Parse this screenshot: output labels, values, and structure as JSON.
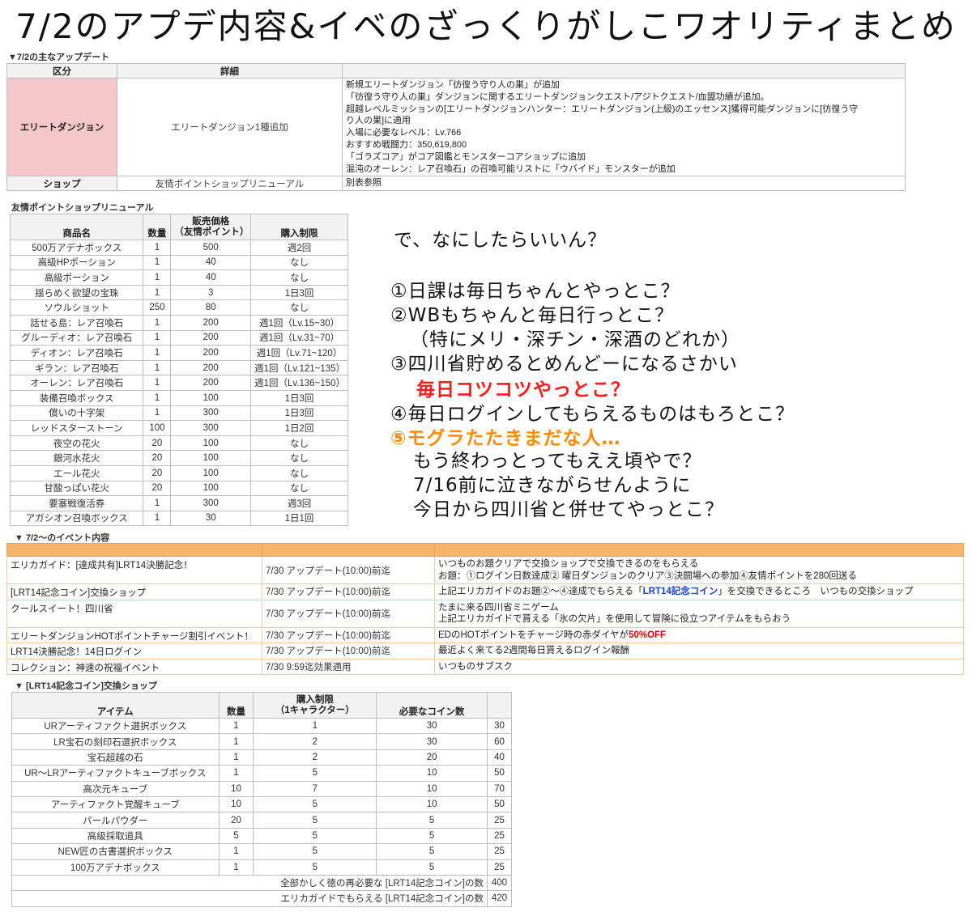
{
  "title": "7/2のアプデ内容&イベのざっくりがしこワオリティまとめ",
  "update_section": {
    "label": "▼7/2の主なアップデート",
    "headers": [
      "区分",
      "詳細",
      ""
    ],
    "rows": [
      {
        "category": "エリートダンジョン",
        "summary": "エリートダンジョン1種追加",
        "details": [
          "新規エリートダンジョン「彷徨う守り人の巣」が追加",
          "「彷徨う守り人の巣」ダンジョンに関するエリートダンジョンクエスト/アジトクエスト/血盟功績が追加。",
          "超越レベルミッションの[エリートダンジョンハンター：エリートダンジョン(上級)のエッセンス]獲得可能ダンジョンに[彷徨う守",
          "り人の巣]に適用",
          "入場に必要なレベル：Lv.766",
          "おすすめ戦闘力：350,619,800",
          "「ゴラズコア」がコア図鑑とモンスターコアショップに追加",
          "混沌のオーレン：レア召喚石」の召喚可能リストに「ウバイド」モンスターが追加"
        ]
      },
      {
        "category": "ショップ",
        "summary": "友情ポイントショップリニューアル",
        "details": [
          "別表参照"
        ]
      }
    ]
  },
  "friend_shop": {
    "label": "友情ポイントショップリニューアル",
    "headers": {
      "name": "商品名",
      "qty": "数量",
      "price": "販売価格\n（友情ポイント）",
      "limit": "購入制限"
    },
    "rows": [
      [
        "500万アデナボックス",
        "1",
        "500",
        "週2回"
      ],
      [
        "高級HPポーション",
        "1",
        "40",
        "なし"
      ],
      [
        "高級ポーション",
        "1",
        "40",
        "なし"
      ],
      [
        "揺らめく欲望の宝珠",
        "1",
        "3",
        "1日3回"
      ],
      [
        "ソウルショット",
        "250",
        "80",
        "なし"
      ],
      [
        "話せる島：レア召喚石",
        "1",
        "200",
        "週1回（Lv.15~30）"
      ],
      [
        "グルーディオ：レア召喚石",
        "1",
        "200",
        "週1回（Lv.31~70）"
      ],
      [
        "ディオン：レア召喚石",
        "1",
        "200",
        "週1回（Lv.71~120）"
      ],
      [
        "ギラン：レア召喚石",
        "1",
        "200",
        "週1回（Lv.121~135）"
      ],
      [
        "オーレン：レア召喚石",
        "1",
        "200",
        "週1回（Lv.136~150）"
      ],
      [
        "装備召喚ボックス",
        "1",
        "100",
        "1日3回"
      ],
      [
        "償いの十字架",
        "1",
        "300",
        "1日3回"
      ],
      [
        "レッドスターストーン",
        "100",
        "300",
        "1日2回"
      ],
      [
        "夜空の花火",
        "20",
        "100",
        "なし"
      ],
      [
        "銀河水花火",
        "20",
        "100",
        "なし"
      ],
      [
        "エール花火",
        "20",
        "100",
        "なし"
      ],
      [
        "甘酸っぱい花火",
        "20",
        "100",
        "なし"
      ],
      [
        "要塞戦復活券",
        "1",
        "300",
        "週3回"
      ],
      [
        "アガシオン召喚ボックス",
        "1",
        "30",
        "1日1回"
      ]
    ]
  },
  "handwritten": {
    "q": "で、なにしたらいいん？",
    "l1": "①日課は毎日ちゃんとやっとこ？",
    "l2": "②WBもちゃんと毎日行っとこ？",
    "l3": "（特にメリ・深チン・深酒のどれか）",
    "l4": "③四川省貯めるとめんどーになるさかい",
    "l5": "毎日コツコツやっとこ？",
    "l6": "④毎日ログインしてもらえるものはもろとこ？",
    "l7": "⑤モグラたたきまだな人…",
    "l8": "もう終わっとってもええ頃やで？",
    "l9": "7/16前に泣きながらせんように",
    "l10": "今日から四川省と併せてやっとこ？"
  },
  "events": {
    "label": "▼ 7/2～のイベント内容",
    "rows": [
      {
        "name": "エリカガイド：[達成共有]LRT14決勝記念！",
        "date": "7/30 アップデート(10:00)前迄",
        "desc1": "いつものお題クリアで交換ショップで交換できるのをもらえる",
        "desc2": "お題：①ログイン日数達成② 曜日ダンジョンのクリア③決闘場への参加④友情ポイントを280回送る"
      },
      {
        "name": "[LRT14記念コイン]交換ショップ",
        "date": "7/30 アップデート(10:00)前迄",
        "desc_a": "上記エリカガイドのお題②～④達成でもらえる「",
        "desc_b": "LRT14記念コイン",
        "desc_c": "」を交換できるところ　いつもの交換ショップ"
      },
      {
        "name": "クールスイート！四川省",
        "date": "7/30 アップデート(10:00)前迄",
        "desc1": "たまに来る四川省ミニゲーム",
        "desc2": "上記エリカガイドで貰える「氷の欠片」を使用して冒険に役立つアイテムをもらおう"
      },
      {
        "name": "エリートダンジョンHOTポイントチャージ割引イベント！",
        "date": "7/30 アップデート(10:00)前迄",
        "desc_a": "EDのHOTポイントをチャージ時の赤ダイヤが",
        "desc_b": "50%OFF"
      },
      {
        "name": "LRT14決勝記念！14日ログイン",
        "date": "7/30 アップデート(10:00)前迄",
        "desc1": "最近よく来てる2週間毎日貰えるログイン報酬"
      },
      {
        "name": "コレクション：神速の祝福イベント",
        "date": "7/30 9:59迄効果適用",
        "desc1": "いつものサブスク"
      }
    ]
  },
  "coin_shop": {
    "label": "▼ [LRT14記念コイン]交換ショップ",
    "headers": {
      "item": "アイテム",
      "qty": "数量",
      "limit": "購入制限\n（1キャラクター）",
      "coins": "必要なコイン数",
      "total": ""
    },
    "rows": [
      [
        "URアーティファクト選択ボックス",
        "1",
        "1",
        "30",
        "30"
      ],
      [
        "LR宝石の刻印石選択ボックス",
        "1",
        "2",
        "30",
        "60"
      ],
      [
        "宝石超越の石",
        "1",
        "2",
        "20",
        "40"
      ],
      [
        "UR～LRアーティファクトキューブボックス",
        "1",
        "5",
        "10",
        "50"
      ],
      [
        "高次元キューブ",
        "10",
        "7",
        "10",
        "70"
      ],
      [
        "アーティファクト覚醒キューブ",
        "10",
        "5",
        "10",
        "50"
      ],
      [
        "パールパウダー",
        "20",
        "5",
        "5",
        "25"
      ],
      [
        "高級採取道具",
        "5",
        "5",
        "5",
        "25"
      ],
      [
        "NEW匠の古書選択ボックス",
        "1",
        "5",
        "5",
        "25"
      ],
      [
        "100万アデナボックス",
        "1",
        "5",
        "5",
        "25"
      ]
    ],
    "footer1_label": "全部かしく徳の再必要な [LRT14記念コイン]の数",
    "footer1_value": "400",
    "footer2_label": "エリカガイドでもらえる [LRT14記念コイン]の数",
    "footer2_value": "420"
  }
}
